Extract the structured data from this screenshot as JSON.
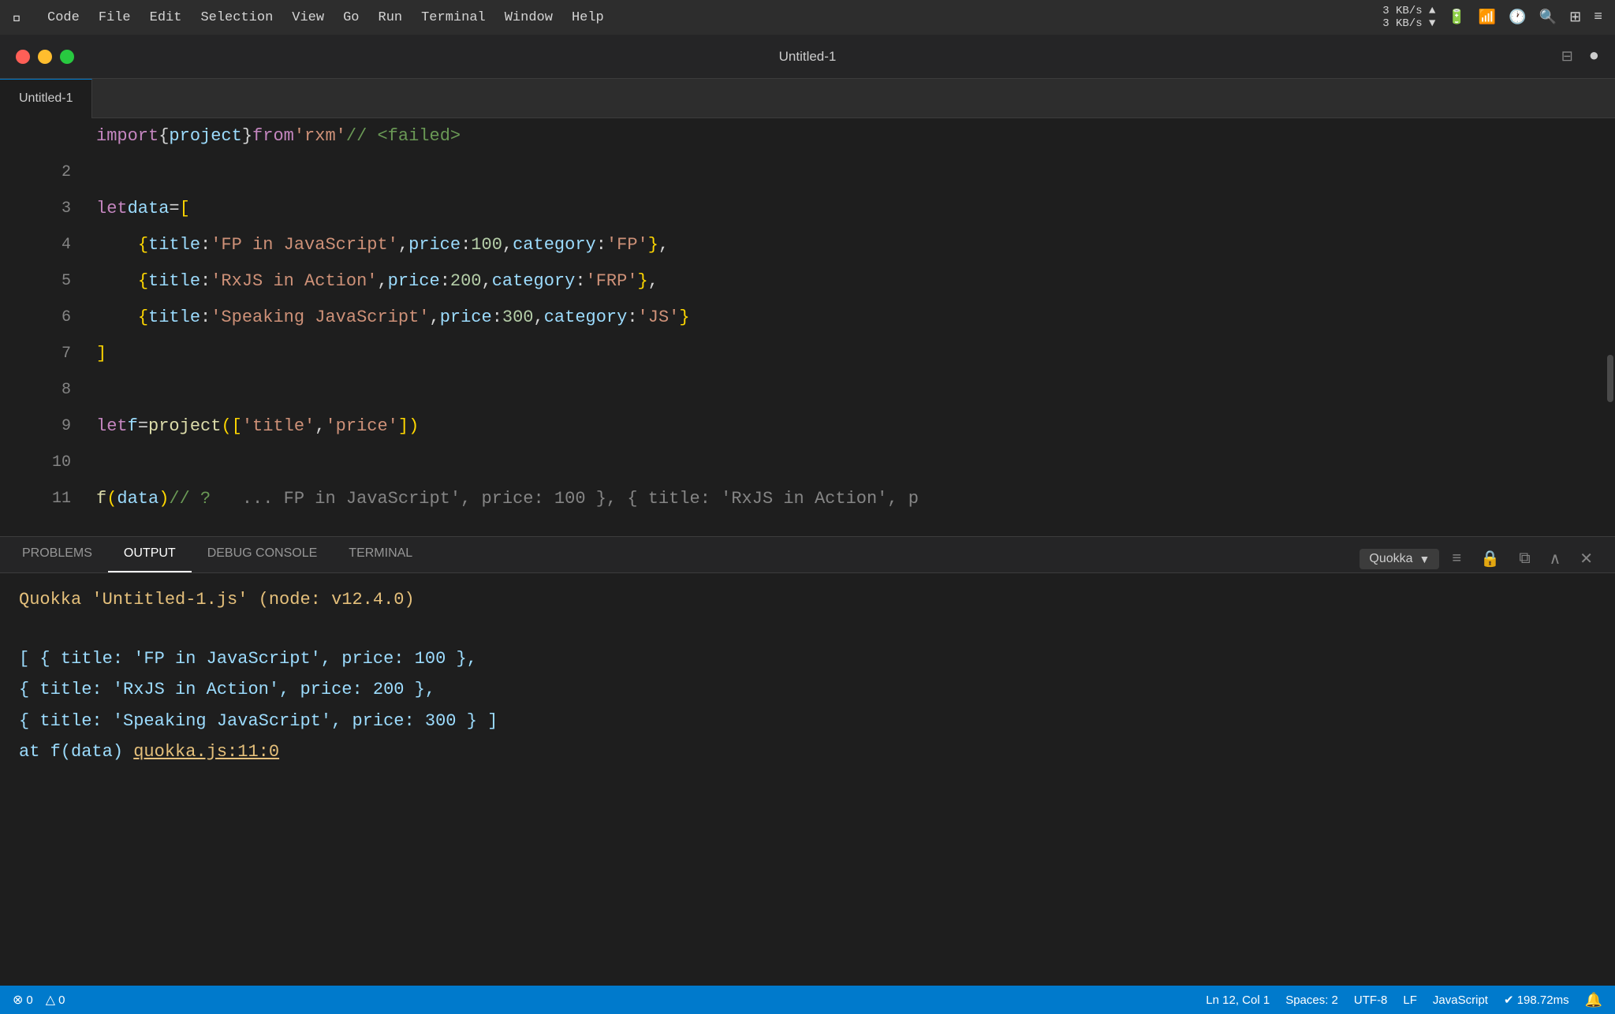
{
  "menubar": {
    "apple": "⌘",
    "items": [
      "Code",
      "File",
      "Edit",
      "Selection",
      "View",
      "Go",
      "Run",
      "Terminal",
      "Window",
      "Help"
    ],
    "right": {
      "bandwidth": "3 KB/s",
      "bandwidth2": "3 KB/s"
    }
  },
  "titlebar": {
    "title": "Untitled-1",
    "tab": "Untitled-1"
  },
  "editor": {
    "lines": [
      {
        "num": "",
        "code_html": ""
      },
      {
        "num": "2",
        "code_html": ""
      },
      {
        "num": "3",
        "code_html": "<span class='kw'>let</span> <span class='var-name'>data</span> <span class='op'>=</span> <span class='bracket'>[</span>",
        "breakpoint": true
      },
      {
        "num": "4",
        "code_html": "    <span class='bracket'>{</span> <span class='key'>title</span><span class='colon'>:</span> <span class='str'>'FP in JavaScript'</span><span class='punc'>,</span> <span class='key'>price</span><span class='colon'>:</span> <span class='num'>100</span><span class='punc'>,</span> <span class='key'>category</span><span class='colon'>:</span> <span class='str'>'FP'</span> <span class='bracket'>}</span><span class='punc'>,</span>"
      },
      {
        "num": "5",
        "code_html": "    <span class='bracket'>{</span> <span class='key'>title</span><span class='colon'>:</span> <span class='str'>'RxJS in Action'</span><span class='punc'>,</span> <span class='key'>price</span><span class='colon'>:</span> <span class='num'>200</span><span class='punc'>,</span> <span class='key'>category</span><span class='colon'>:</span> <span class='str'>'FRP'</span> <span class='bracket'>}</span><span class='punc'>,</span>"
      },
      {
        "num": "6",
        "code_html": "    <span class='bracket'>{</span> <span class='key'>title</span><span class='colon'>:</span> <span class='str'>'Speaking JavaScript'</span><span class='punc'>,</span> <span class='key'>price</span><span class='colon'>:</span> <span class='num'>300</span><span class='punc'>,</span> <span class='key'>category</span><span class='colon'>:</span> <span class='str'>'JS'</span> <span class='bracket'>}</span>"
      },
      {
        "num": "7",
        "code_html": "<span class='bracket'>]</span>"
      },
      {
        "num": "8",
        "code_html": ""
      },
      {
        "num": "9",
        "code_html": "<span class='kw'>let</span> <span class='var-name'>f</span> <span class='op'>=</span> <span class='fn'>project</span><span class='bracket'>([</span><span class='str'>'title'</span><span class='punc'>,</span> <span class='str'>'price'</span><span class='bracket'>])</span>",
        "breakpoint": true
      },
      {
        "num": "10",
        "code_html": ""
      },
      {
        "num": "11",
        "code_html": "<span class='fn'>f</span><span class='bracket'>(</span><span class='var-name'>data</span><span class='bracket'>)</span> <span class='comment'>// ?</span>   <span class='gray'>... FP in JavaScript', price: 100 }, { title: 'RxJS in Action', p</span>",
        "breakpoint": true
      }
    ]
  },
  "panel": {
    "tabs": [
      "PROBLEMS",
      "OUTPUT",
      "DEBUG CONSOLE",
      "TERMINAL"
    ],
    "active_tab": "OUTPUT",
    "dropdown_value": "Quokka",
    "output": {
      "header": "Quokka 'Untitled-1.js' (node: v12.4.0)",
      "lines": [
        "[ { title: 'FP in JavaScript', price: 100 },",
        "  { title: 'RxJS in Action', price: 200 },",
        "  { title: 'Speaking JavaScript', price: 300 } ]",
        "  at f(data) quokka.js:11:0"
      ],
      "at_prefix": "  at f(data) ",
      "quokka_link": "quokka.js:11:0"
    }
  },
  "statusbar": {
    "error_count": "0",
    "warning_count": "0",
    "position": "Ln 12, Col 1",
    "spaces": "Spaces: 2",
    "encoding": "UTF-8",
    "line_ending": "LF",
    "language": "JavaScript",
    "timing": "✔ 198.72ms"
  }
}
